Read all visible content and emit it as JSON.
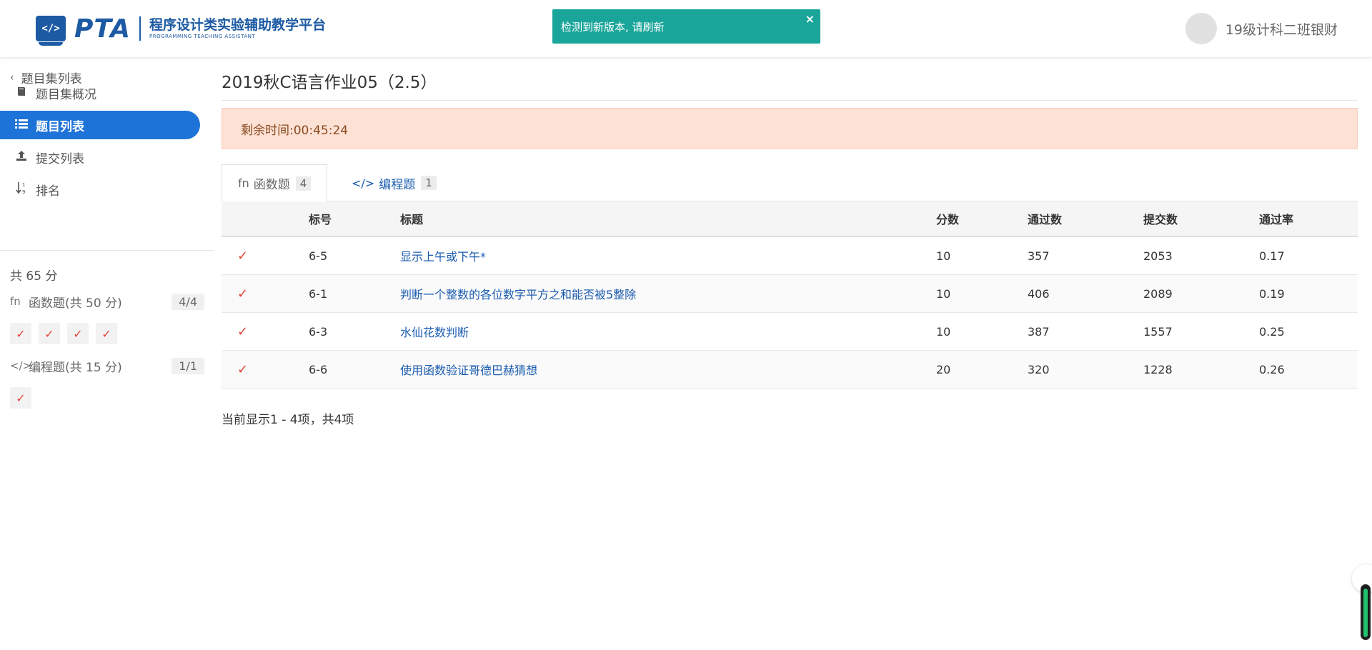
{
  "header": {
    "logo_mark": "</>",
    "logo_text": "PTA",
    "logo_sub_cn": "程序设计类实验辅助教学平台",
    "logo_sub_en": "PROGRAMMING TEACHING ASSISTANT",
    "toast": "检测到新版本, 请刷新",
    "toast_close": "×",
    "username": "19级计科二班银财"
  },
  "sidebar": {
    "back_label": "题目集列表",
    "items": [
      {
        "label": "题目集概况",
        "icon": "book-icon"
      },
      {
        "label": "题目列表",
        "icon": "list-icon",
        "active": true
      },
      {
        "label": "提交列表",
        "icon": "upload-icon"
      },
      {
        "label": "排名",
        "icon": "sort-icon"
      }
    ],
    "total": "共 65 分",
    "categories": [
      {
        "icon": "fn-icon",
        "label": "函数题(共 50 分)",
        "count": "4/4",
        "checks": 4
      },
      {
        "icon": "code-icon",
        "label": "编程题(共 15 分)",
        "count": "1/1",
        "checks": 1
      }
    ]
  },
  "main": {
    "title": "2019秋C语言作业05（2.5）",
    "timer": "剩余时间:00:45:24",
    "tabs": [
      {
        "label": "函数题",
        "icon": "fn",
        "count": "4",
        "active": true
      },
      {
        "label": "编程题",
        "icon": "</>",
        "count": "1",
        "active": false
      }
    ],
    "columns": [
      "标号",
      "标题",
      "分数",
      "通过数",
      "提交数",
      "通过率"
    ],
    "rows": [
      {
        "status": "✓",
        "id": "6-5",
        "title": "显示上午或下午*",
        "score": "10",
        "passed": "357",
        "submitted": "2053",
        "rate": "0.17"
      },
      {
        "status": "✓",
        "id": "6-1",
        "title": "判断一个整数的各位数字平方之和能否被5整除",
        "score": "10",
        "passed": "406",
        "submitted": "2089",
        "rate": "0.19"
      },
      {
        "status": "✓",
        "id": "6-3",
        "title": "水仙花数判断",
        "score": "10",
        "passed": "387",
        "submitted": "1557",
        "rate": "0.25"
      },
      {
        "status": "✓",
        "id": "6-6",
        "title": "使用函数验证哥德巴赫猜想",
        "score": "20",
        "passed": "320",
        "submitted": "1228",
        "rate": "0.26"
      }
    ],
    "pager": "当前显示1 - 4项，共4项"
  },
  "colors": {
    "brand": "#1c5aa3",
    "active_nav": "#1e73d8",
    "toast": "#1aa59a",
    "check": "#e0443a",
    "timer_bg": "#fde1d5",
    "link": "#1a5bb0"
  }
}
